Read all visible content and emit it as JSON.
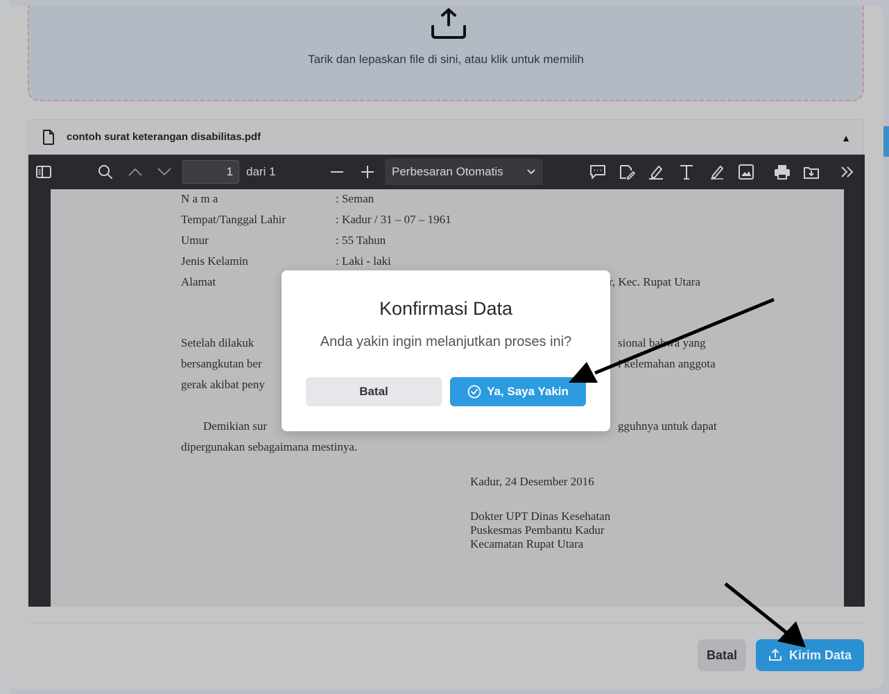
{
  "dropzone": {
    "text": "Tarik dan lepaskan file di sini, atau klik untuk memilih"
  },
  "file": {
    "name": "contoh surat keterangan disabilitas.pdf"
  },
  "pdf_toolbar": {
    "page_number": "1",
    "page_of": "dari 1",
    "zoom": "Perbesaran Otomatis"
  },
  "document": {
    "lines": [
      "N a m a",
      ": Seman",
      "Tempat/Tanggal Lahir",
      ": Kadur / 31 – 07 – 1961",
      "Umur",
      ": 55 Tahun",
      "Jenis Kelamin",
      ": Laki - laki",
      "Alamat",
      "r,  Kec.  Rupat  Utara",
      "Setelah   dilakuk",
      "sional   bahwa   yang",
      "bersangkutan ber",
      "i kelemahan anggota",
      "gerak akibat peny",
      "Demikian sur",
      "gguhnya untuk dapat",
      "dipergunakan sebagaimana mestinya.",
      "Kadur, 24 Desember 2016",
      "Dokter UPT Dinas Kesehatan",
      "Puskesmas Pembantu Kadur",
      "Kecamatan Rupat Utara"
    ]
  },
  "confirm": {
    "title": "Konfirmasi Data",
    "message": "Anda yakin ingin melanjutkan proses ini?",
    "cancel_label": "Batal",
    "ok_label": "Ya, Saya Yakin"
  },
  "footer": {
    "cancel_label": "Batal",
    "submit_label": "Kirim Data"
  },
  "colors": {
    "primary": "#2c9be0",
    "dropzone_border": "#d98c98",
    "toolbar_bg": "#2b2b2f"
  }
}
